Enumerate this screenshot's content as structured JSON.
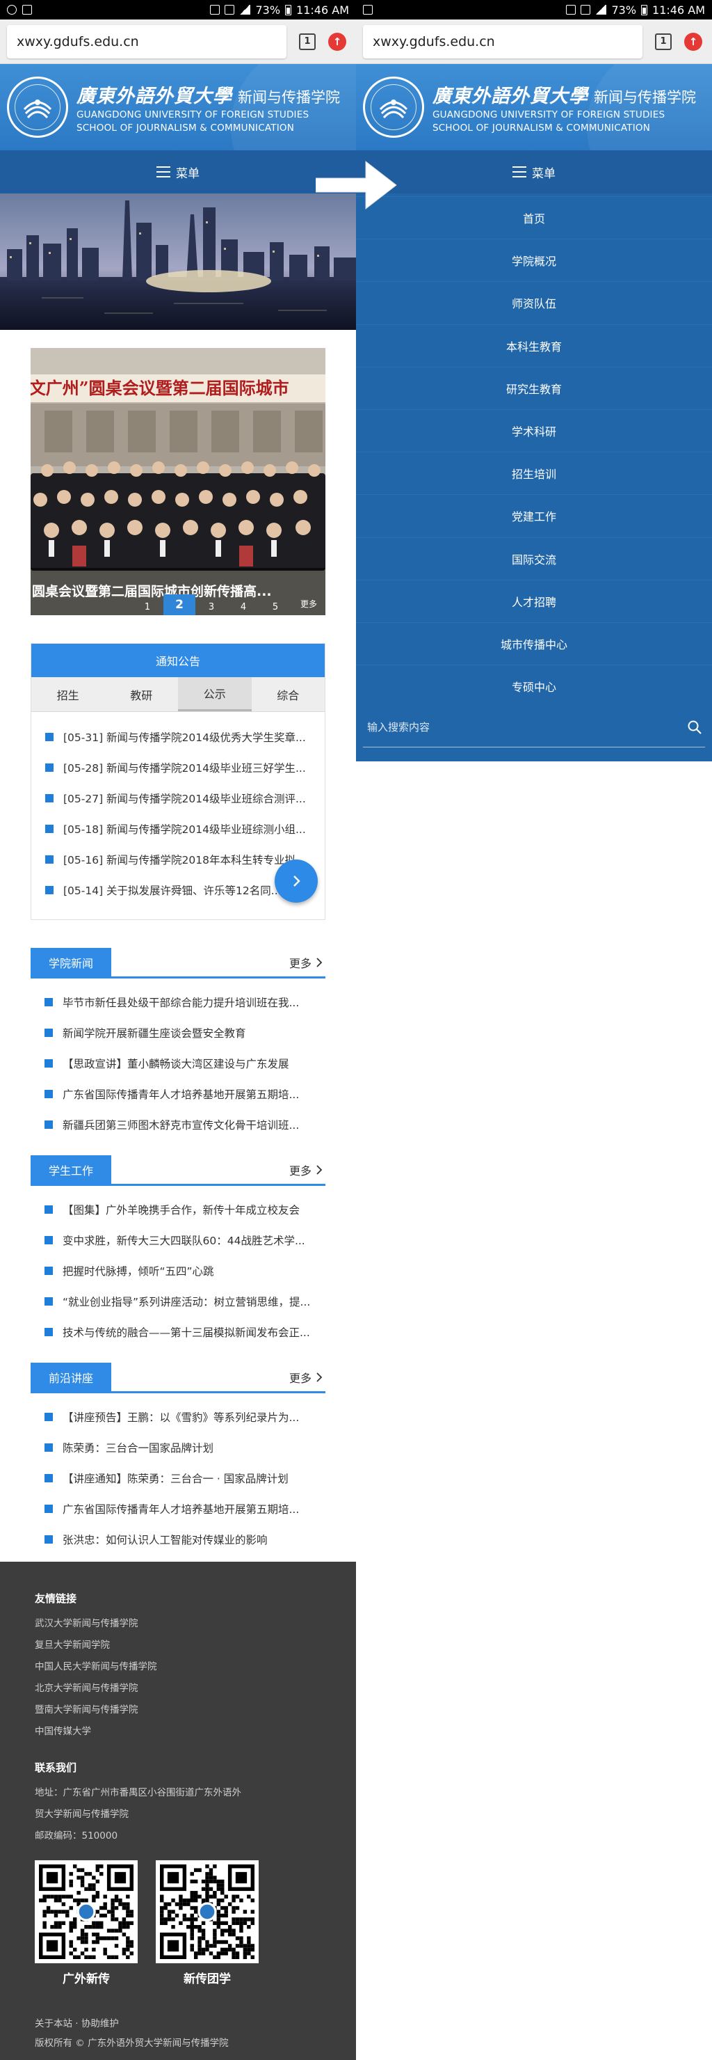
{
  "status_bar": {
    "battery": "73%",
    "time": "11:46 AM"
  },
  "browser": {
    "url": "xwxy.gdufs.edu.cn",
    "tab_count": "1"
  },
  "site": {
    "logo_calligraphy": "廣東外語外貿大學",
    "name_cn": "新闻与传播学院",
    "name_en_1": "GUANGDONG UNIVERSITY OF FOREIGN STUDIES",
    "name_en_2": "SCHOOL OF JOURNALISM & COMMUNICATION",
    "menu_label": "菜单"
  },
  "slideshow": {
    "banner_text": "“人文广州”圆桌会议暨第二届国际城市",
    "caption": "圆桌会议暨第二届国际城市创新传播高...",
    "dots": [
      "1",
      "2",
      "3",
      "4",
      "5"
    ],
    "active_dot": 1,
    "more": "更多"
  },
  "notice": {
    "header": "通知公告",
    "tabs": [
      "招生",
      "教研",
      "公示",
      "综合"
    ],
    "active_tab": 2,
    "items": [
      "[05-31] 新闻与传播学院2014级优秀大学生奖章...",
      "[05-28] 新闻与传播学院2014级毕业班三好学生...",
      "[05-27] 新闻与传播学院2014级毕业班综合测评...",
      "[05-18] 新闻与传播学院2014级毕业班综测小组...",
      "[05-16] 新闻与传播学院2018年本科生转专业拟...",
      "[05-14] 关于拟发展许舜钿、许乐等12名同..."
    ]
  },
  "sections": {
    "more_label": "更多",
    "news": {
      "title": "学院新闻",
      "items": [
        "毕节市新任县处级干部综合能力提升培训班在我...",
        "新闻学院开展新疆生座谈会暨安全教育",
        "【思政宣讲】董小麟畅谈大湾区建设与广东发展",
        "广东省国际传播青年人才培养基地开展第五期培...",
        "新疆兵团第三师图木舒克市宣传文化骨干培训班..."
      ]
    },
    "student": {
      "title": "学生工作",
      "items": [
        "【图集】广外羊晚携手合作，新传十年成立校友会",
        "变中求胜，新传大三大四联队60：44战胜艺术学...",
        "把握时代脉搏，倾听“五四”心跳",
        "“就业创业指导”系列讲座活动：树立营销思维，提...",
        "技术与传统的融合——第十三届模拟新闻发布会正..."
      ]
    },
    "lecture": {
      "title": "前沿讲座",
      "items": [
        "【讲座预告】王鹏：以《雪豹》等系列纪录片为...",
        "陈荣勇：三台合一国家品牌计划",
        "【讲座通知】陈荣勇：三台合一 · 国家品牌计划",
        "广东省国际传播青年人才培养基地开展第五期培...",
        "张洪忠：如何认识人工智能对传媒业的影响"
      ]
    }
  },
  "footer": {
    "links_title": "友情链接",
    "links": [
      "武汉大学新闻与传播学院",
      "复旦大学新闻学院",
      "中国人民大学新闻与传播学院",
      "北京大学新闻与传播学院",
      "暨南大学新闻与传播学院",
      "中国传媒大学"
    ],
    "contact_title": "联系我们",
    "address_1": "地址：广东省广州市番禺区小谷围街道广东外语外",
    "address_2": "贸大学新闻与传播学院",
    "postcode": "邮政编码：510000",
    "qr_1": "广外新传",
    "qr_2": "新传团学",
    "about": "关于本站 · 协助维护",
    "copyright": "版权所有 © 广东外语外贸大学新闻与传播学院"
  },
  "menu": {
    "items": [
      "首页",
      "学院概况",
      "师资队伍",
      "本科生教育",
      "研究生教育",
      "学术科研",
      "招生培训",
      "党建工作",
      "国际交流",
      "人才招聘",
      "城市传播中心",
      "专硕中心"
    ],
    "search_placeholder": "输入搜索内容"
  },
  "colors": {
    "header_blue": "#2b79c4",
    "menubar_blue": "#1f5d9e",
    "accent_blue": "#2f8be6",
    "footer_gray": "#3d3d3d"
  }
}
